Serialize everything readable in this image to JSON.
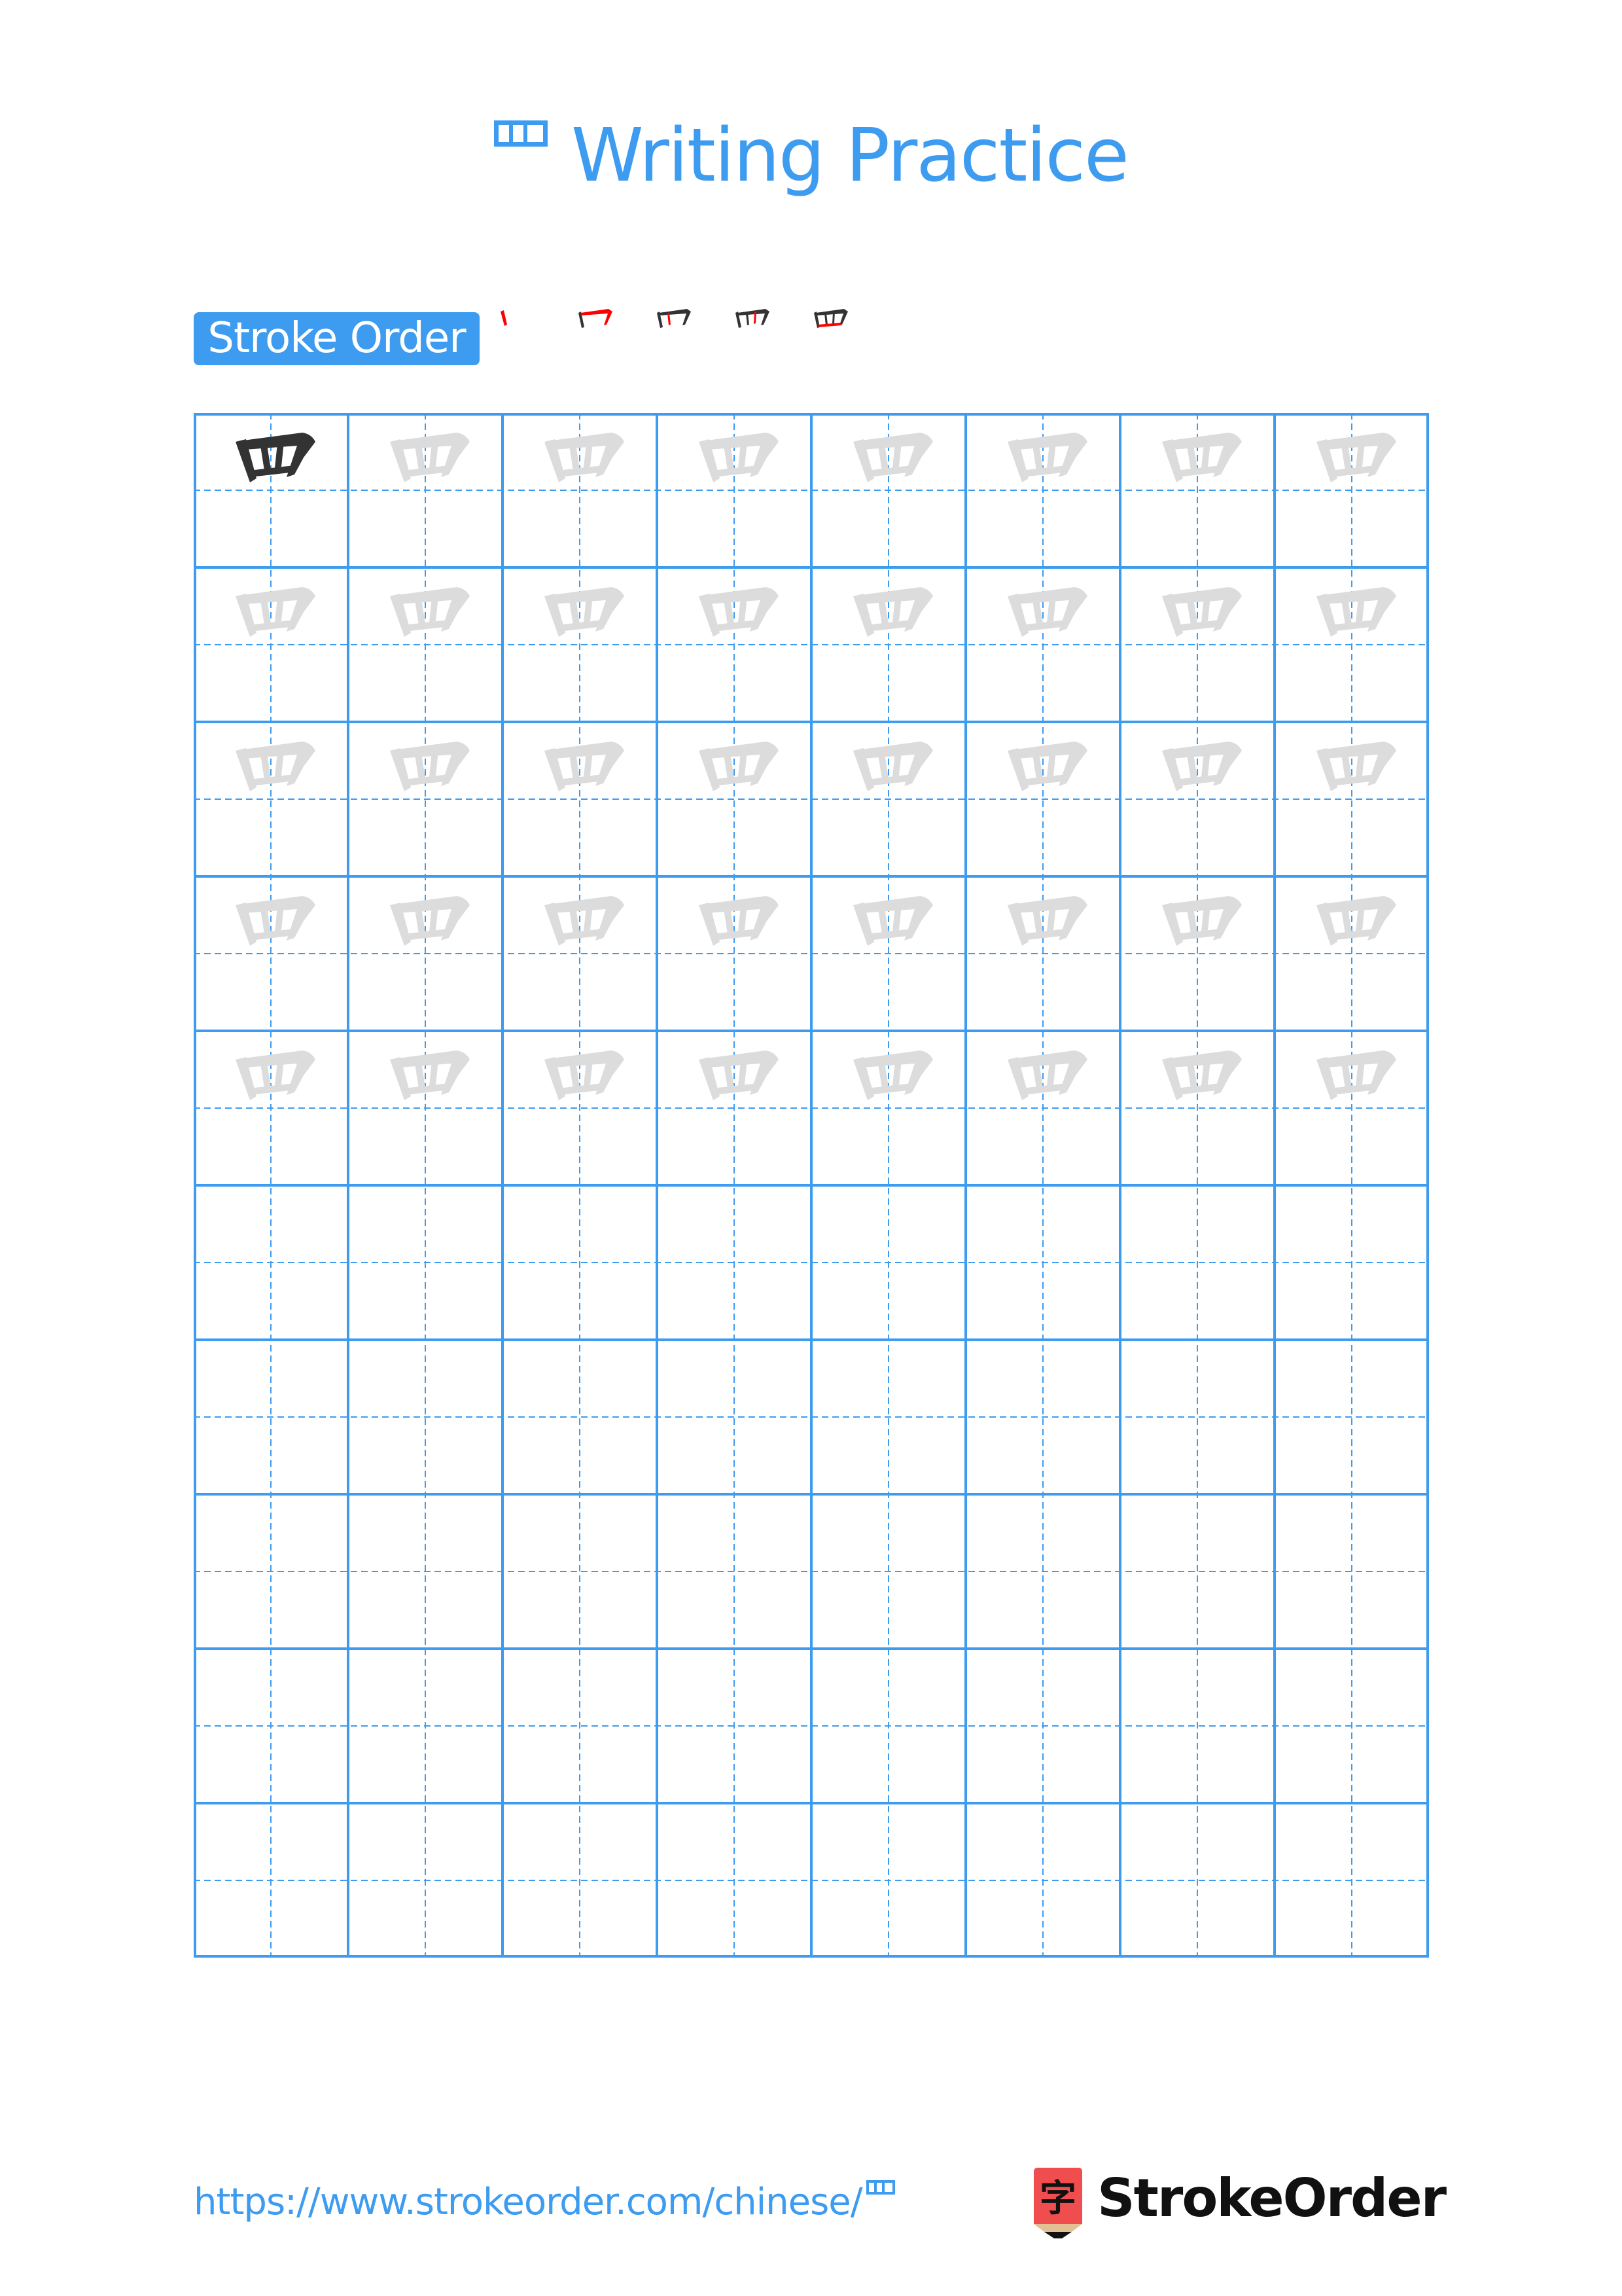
{
  "page": {
    "character": "罒",
    "title_suffix": "Writing Practice",
    "stroke_order_label": "Stroke Order",
    "stroke_count": 5,
    "grid": {
      "columns": 8,
      "rows": 10,
      "rows_with_traces": 5,
      "model_cells": 1
    },
    "colors": {
      "accent": "#3d9bf0",
      "grid_line": "#3d9bf0",
      "model_char": "#333333",
      "trace_char": "#dcdcdc",
      "current_stroke": "#ff0000",
      "logo_red": "#f04e4e",
      "logo_tan": "#e3bf94"
    },
    "footer": {
      "url_text": "https://www.strokeorder.com/chinese/",
      "brand": "StrokeOrder",
      "logo_glyph": "字"
    }
  }
}
